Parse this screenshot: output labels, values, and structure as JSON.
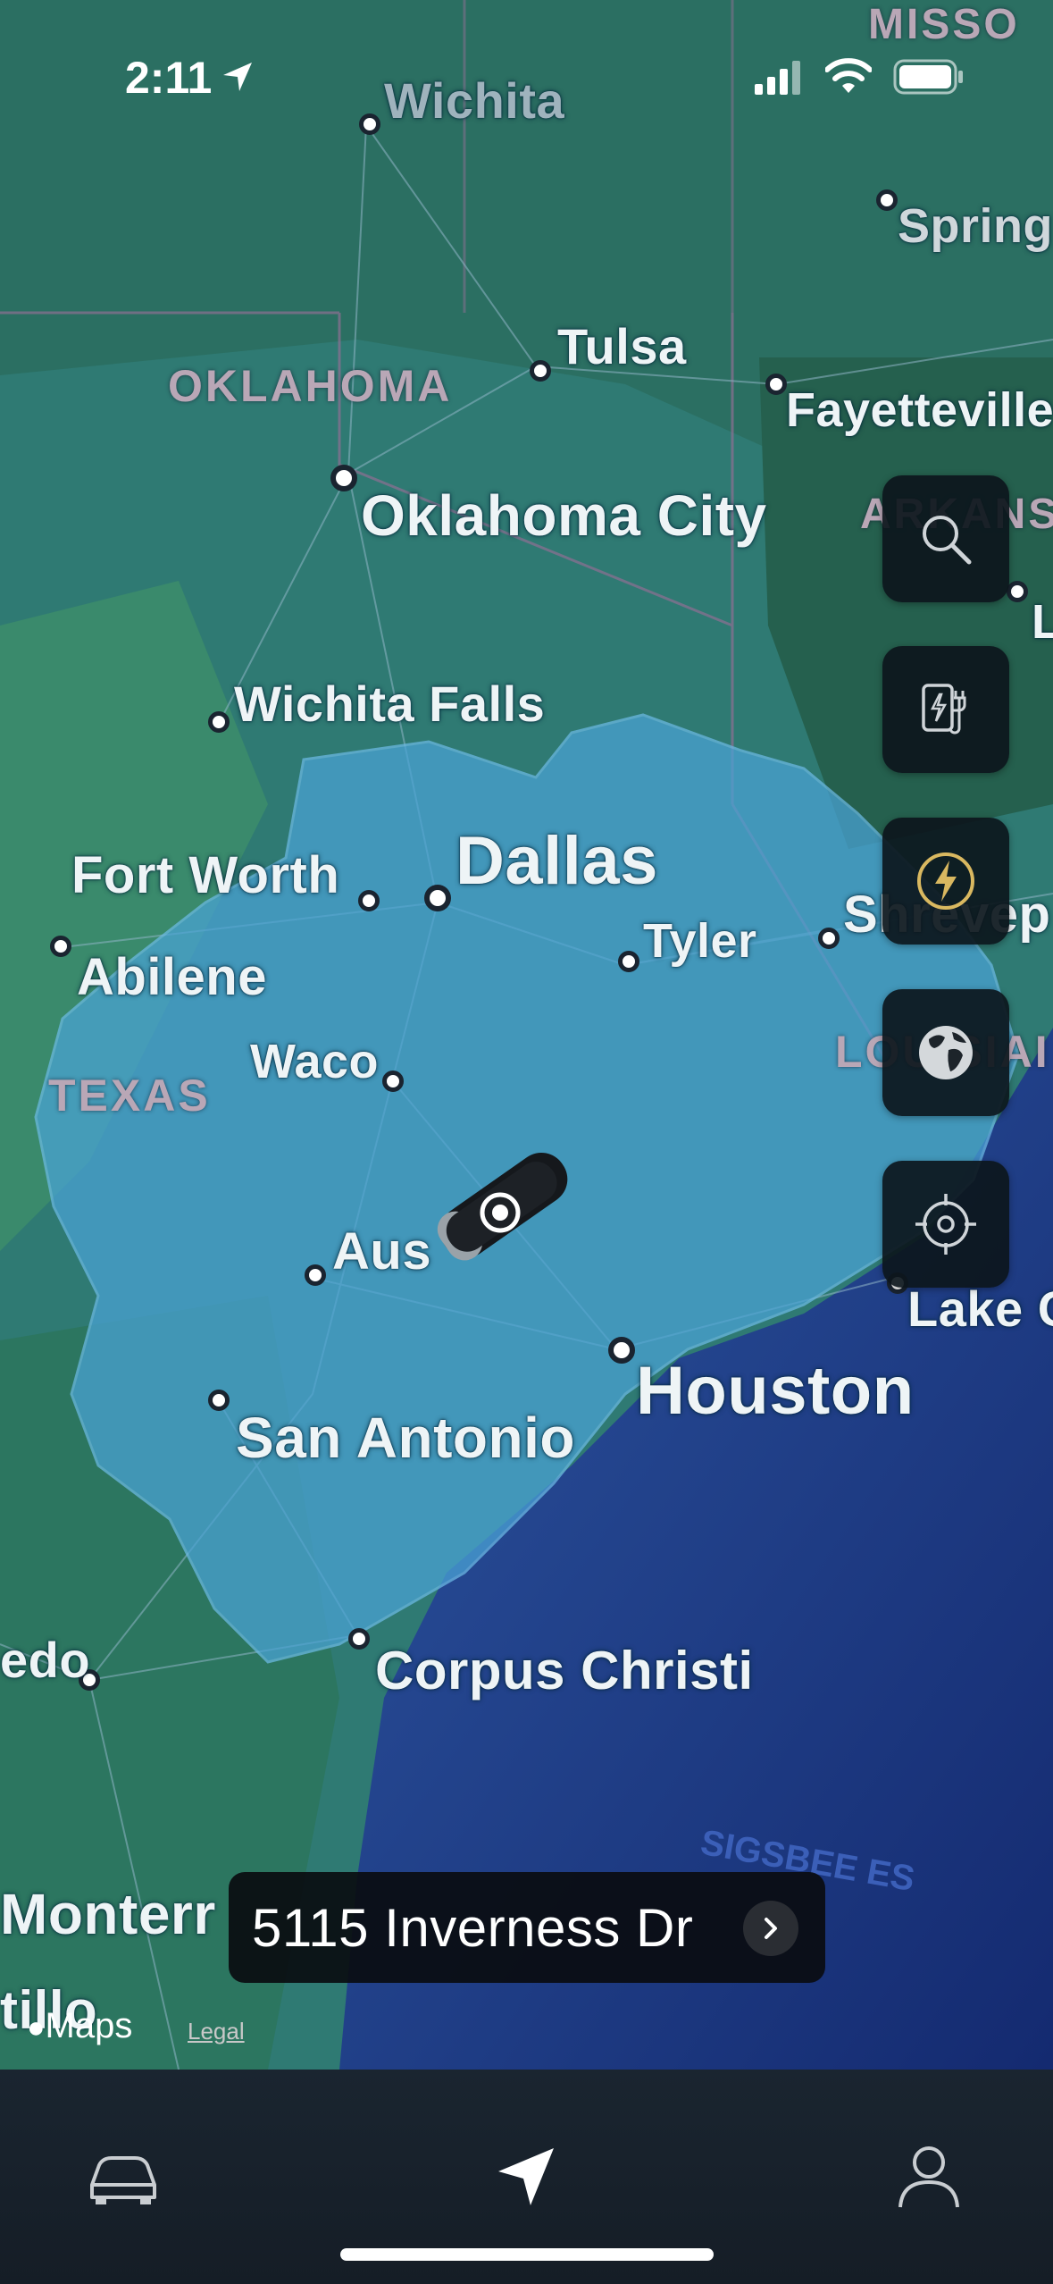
{
  "status_bar": {
    "time": "2:11",
    "location_arrow_icon": "location-arrow-icon",
    "signal_icon": "cellular-signal-icon",
    "wifi_icon": "wifi-icon",
    "battery_icon": "battery-icon"
  },
  "map": {
    "cities": [
      "Wichita",
      "Tulsa",
      "Spring",
      "Fayetteville",
      "Oklahoma City",
      "Wichita Falls",
      "Dallas",
      "Fort Worth",
      "Tyler",
      "Shrevep",
      "Abilene",
      "Waco",
      "Aus",
      "Houston",
      "San Antonio",
      "Lake C",
      "Corpus Christi",
      "edo",
      "Monterr",
      "tillo",
      "L"
    ],
    "states": [
      "MISSO",
      "OKLAHOMA",
      "ARKANS",
      "TEXAS",
      "LOUISIAI"
    ],
    "water_label": "SIGSBEE ES",
    "range_overlay_color": "#4aa3d6",
    "vehicle_marker": "car-marker-icon"
  },
  "side_controls": {
    "search": "search-icon",
    "charger": "charger-icon",
    "supercharger": "lightning-icon",
    "satellite": "globe-icon",
    "recenter": "crosshair-icon"
  },
  "destination": {
    "address": "5115 Inverness Dr"
  },
  "attribution": {
    "maps": "Maps",
    "legal": "Legal"
  },
  "tab_bar": {
    "vehicle": "car-icon",
    "navigation": "navigation-arrow-icon",
    "profile": "profile-icon"
  }
}
